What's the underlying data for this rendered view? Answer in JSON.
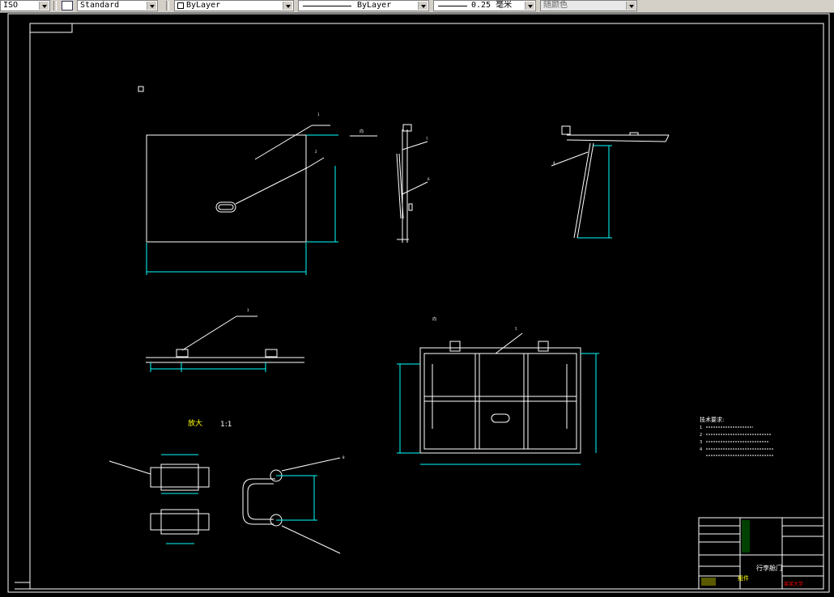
{
  "toolbar": {
    "textstyle_label": "Standard",
    "layer_label": "ByLayer",
    "linetype_label": "ByLayer",
    "lineweight_label": "0.25 毫米",
    "color_label": "随颜色",
    "left_fragment": "ISO"
  },
  "drawing": {
    "view_label_a": "向",
    "view_label_b": "向",
    "scale_label": "1:1",
    "scale_prefix": "放大",
    "notes_title": "技术要求:",
    "notes": [
      "1",
      "2",
      "3",
      "4"
    ],
    "title_block": {
      "part_name": "行李舱门",
      "material": "组件",
      "school": "某某大学"
    },
    "leader_numbers": [
      "1",
      "2",
      "3",
      "4",
      "5",
      "6",
      "7",
      "8"
    ]
  },
  "colors": {
    "background": "#000000",
    "frame": "#ffffff",
    "dimension": "#00ffff",
    "highlight": "#ff0000",
    "yellow": "#ffff00",
    "green": "#00ff00"
  }
}
